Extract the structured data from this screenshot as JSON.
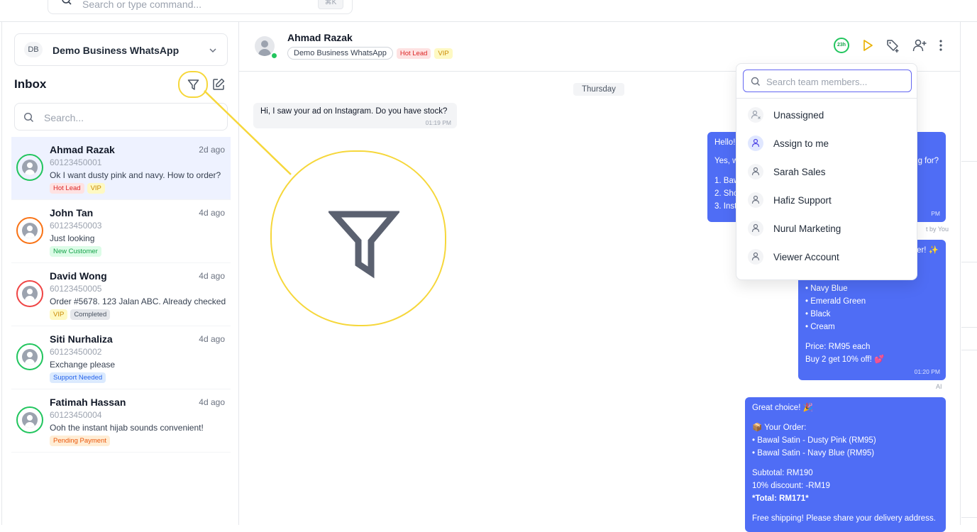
{
  "topbar": {
    "search_placeholder": "Search or type command...",
    "shortcut": "⌘K"
  },
  "sidebar": {
    "account": {
      "initials": "DB",
      "name": "Demo Business WhatsApp"
    },
    "title": "Inbox",
    "search_placeholder": "Search...",
    "conversations": [
      {
        "name": "Ahmad Razak",
        "time": "2d ago",
        "phone": "60123450001",
        "message": "Ok I want dusty pink and navy. How to order?",
        "tags": [
          "Hot Lead",
          "VIP"
        ],
        "ring_color": "#22c55e",
        "active": true
      },
      {
        "name": "John Tan",
        "time": "4d ago",
        "phone": "60123450003",
        "message": "Just looking",
        "tags": [
          "New Customer"
        ],
        "ring_color": "#f97316"
      },
      {
        "name": "David Wong",
        "time": "4d ago",
        "phone": "60123450005",
        "message": "Order #5678. 123 Jalan ABC. Already checked w",
        "tags": [
          "VIP",
          "Completed"
        ],
        "ring_color": "#ef4444"
      },
      {
        "name": "Siti Nurhaliza",
        "time": "4d ago",
        "phone": "60123450002",
        "message": "Exchange please",
        "tags": [
          "Support Needed"
        ],
        "ring_color": "#22c55e"
      },
      {
        "name": "Fatimah Hassan",
        "time": "4d ago",
        "phone": "60123450004",
        "message": "Ooh the instant hijab sounds convenient!",
        "tags": [
          "Pending Payment"
        ],
        "ring_color": "#22c55e"
      }
    ]
  },
  "chat": {
    "contact_name": "Ahmad Razak",
    "account_pill": "Demo Business WhatsApp",
    "tags": [
      "Hot Lead",
      "VIP"
    ],
    "timer": "23h",
    "day_label": "Thursday",
    "messages": {
      "incoming_1": {
        "text": "Hi, I saw your ad on Instagram. Do you have stock?",
        "time": "01:19 PM"
      },
      "outgoing_1": {
        "lines": [
          "Hello!",
          "",
          "Yes, w",
          "",
          "1. Baw",
          "2. Sho",
          "3. Inst"
        ],
        "right_fragment": "g for?",
        "time": "PM"
      },
      "outgoing_1_note": "t by You",
      "outgoing_2": {
        "lines": [
          "er! ✨",
          "",
          "• Dusty Pink",
          "• Navy Blue",
          "• Emerald Green",
          "• Black",
          "• Cream",
          "",
          "Price: RM95 each",
          "Buy 2 get 10% off! 💕"
        ],
        "time": "01:20 PM"
      },
      "outgoing_2_note": "AI",
      "outgoing_3": {
        "lines": [
          "Great choice! 🎉",
          "",
          "📦 Your Order:",
          "• Bawal Satin - Dusty Pink (RM95)",
          "• Bawal Satin - Navy Blue (RM95)",
          "",
          "Subtotal: RM190",
          "10% discount: -RM19",
          "*Total: RM171*",
          "",
          "Free shipping! Please share your delivery address."
        ]
      }
    }
  },
  "assign_dropdown": {
    "search_placeholder": "Search team members...",
    "items": [
      "Unassigned",
      "Assign to me",
      "Sarah Sales",
      "Hafiz Support",
      "Nurul Marketing",
      "Viewer Account"
    ]
  },
  "colors": {
    "accent": "#4f6df5",
    "highlight": "#f6d73b",
    "online": "#22c55e"
  }
}
